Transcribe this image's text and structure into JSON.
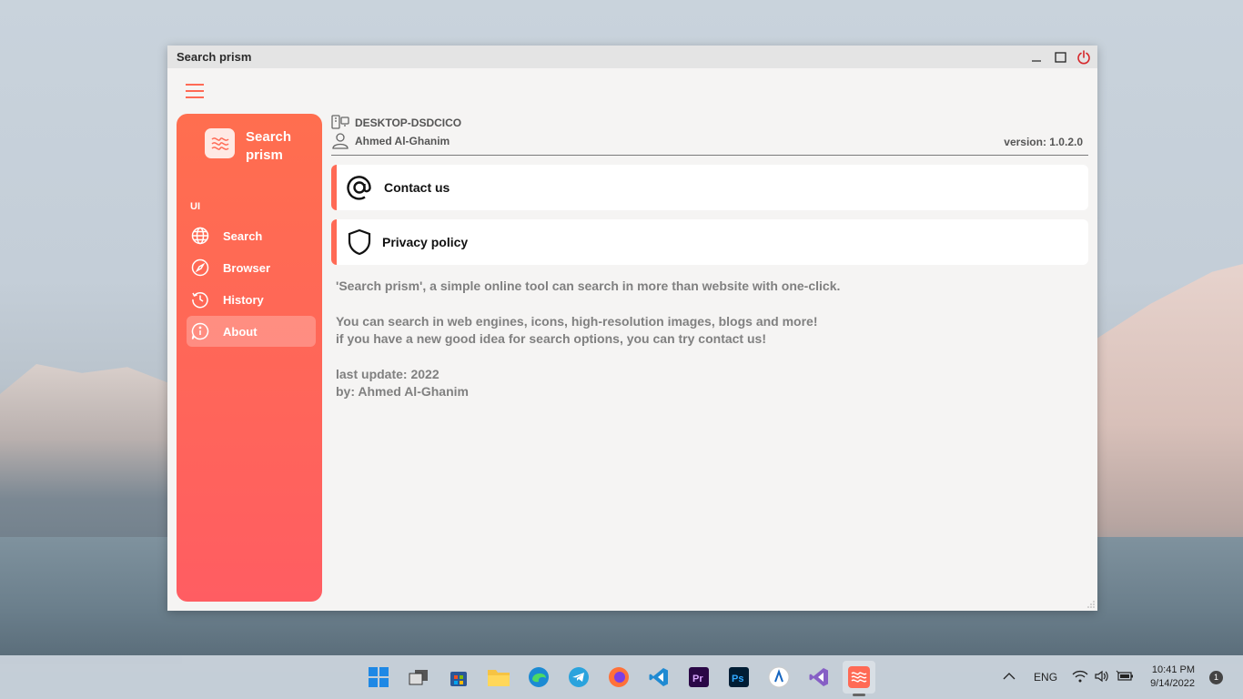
{
  "window": {
    "title": "Search prism"
  },
  "brand": {
    "name": "Search prism"
  },
  "sidebar": {
    "section_label": "UI",
    "items": [
      {
        "label": "Search",
        "icon": "globe-icon"
      },
      {
        "label": "Browser",
        "icon": "compass-icon"
      },
      {
        "label": "History",
        "icon": "history-icon"
      },
      {
        "label": "About",
        "icon": "info-icon",
        "active": true
      }
    ]
  },
  "info": {
    "computer_name": "DESKTOP-DSDCICO",
    "user_name": "Ahmed Al-Ghanim",
    "version": "version: 1.0.2.0"
  },
  "cards": [
    {
      "label": "Contact us",
      "icon": "at-icon"
    },
    {
      "label": "Privacy policy",
      "icon": "shield-icon"
    }
  ],
  "about": {
    "line1": "'Search prism', a simple online tool can search in more than website with one-click.",
    "line2": "You can search in web engines, icons, high-resolution images, blogs and more!",
    "line3": "if you have a new good idea for search options, you can try contact us!",
    "line4": "last update: 2022",
    "line5": "by: Ahmed Al-Ghanim"
  },
  "taskbar": {
    "apps": [
      "start",
      "task-view",
      "store",
      "file-explorer",
      "edge",
      "telegram",
      "firefox",
      "vscode",
      "premiere",
      "photoshop",
      "app",
      "visual-studio",
      "search-prism"
    ],
    "language": "ENG",
    "time": "10:41 PM",
    "date": "9/14/2022",
    "notification_count": "1"
  },
  "colors": {
    "accent": "#ff6a55",
    "sidebar_top": "#ff6e4f",
    "sidebar_bottom": "#ff5d62"
  }
}
